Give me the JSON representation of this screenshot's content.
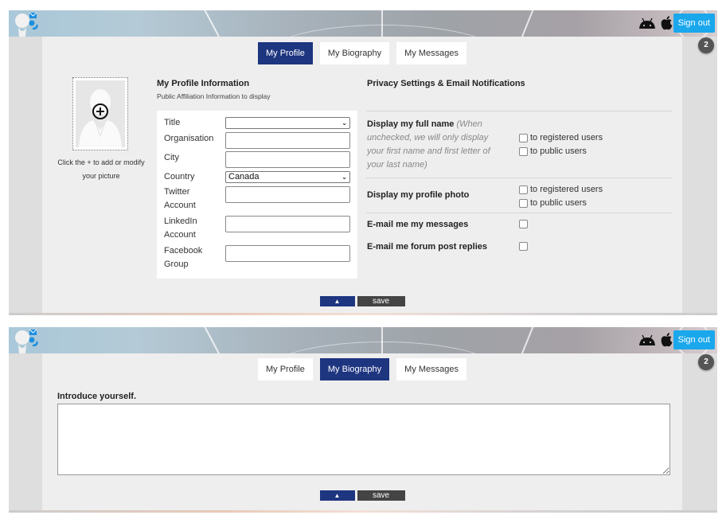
{
  "header": {
    "signout_label": "Sign out",
    "notification_count": "2",
    "os_icons": [
      "android-icon",
      "apple-icon"
    ],
    "accent_color": "#1aa7ec"
  },
  "tabs": [
    {
      "label": "My Profile"
    },
    {
      "label": "My Biography"
    },
    {
      "label": "My Messages"
    }
  ],
  "profile_view": {
    "active_tab": "My Profile",
    "photo": {
      "caption": "Click the + to add or modify your picture"
    },
    "profile_info": {
      "title": "My Profile Information",
      "subtitle": "Public Affiliation Information to display",
      "fields": [
        {
          "label": "Title",
          "type": "select",
          "value": ""
        },
        {
          "label": "Organisation",
          "type": "text",
          "value": ""
        },
        {
          "label": "City",
          "type": "text",
          "value": ""
        },
        {
          "label": "Country",
          "type": "select",
          "value": "Canada"
        },
        {
          "label": "Twitter Account",
          "type": "text",
          "value": ""
        },
        {
          "label": "LinkedIn Account",
          "type": "text",
          "value": ""
        },
        {
          "label": "Facebook Group",
          "type": "text",
          "value": ""
        }
      ]
    },
    "privacy": {
      "title": "Privacy Settings & Email Notifications",
      "rows": [
        {
          "label": "Display my full name",
          "note": "(When unchecked, we will only display your first name and first letter of your last name)",
          "options": [
            {
              "label": "to registered users",
              "checked": false
            },
            {
              "label": "to public users",
              "checked": false
            }
          ]
        },
        {
          "label": "Display my profile photo",
          "options": [
            {
              "label": "to registered users",
              "checked": false
            },
            {
              "label": "to public users",
              "checked": false
            }
          ]
        },
        {
          "label": "E-mail me my messages",
          "checked": false
        },
        {
          "label": "E-mail me forum post replies",
          "checked": false
        }
      ]
    },
    "actions": {
      "up_label": "▲",
      "save_label": "save"
    }
  },
  "biography_view": {
    "active_tab": "My Biography",
    "prompt": "Introduce yourself.",
    "text": "",
    "actions": {
      "up_label": "▲",
      "save_label": "save"
    }
  },
  "colors": {
    "active_tab": "#1e3580",
    "save_button": "#444444",
    "badge": "#555555"
  }
}
